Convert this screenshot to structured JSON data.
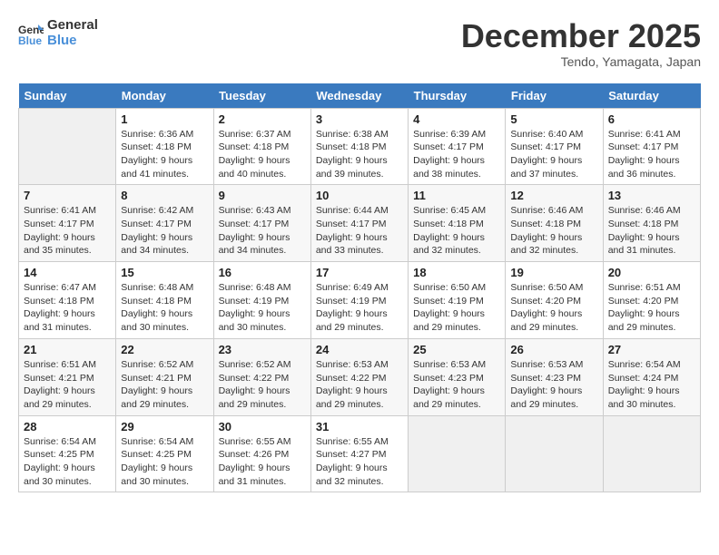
{
  "logo": {
    "line1": "General",
    "line2": "Blue"
  },
  "title": "December 2025",
  "subtitle": "Tendo, Yamagata, Japan",
  "days_of_week": [
    "Sunday",
    "Monday",
    "Tuesday",
    "Wednesday",
    "Thursday",
    "Friday",
    "Saturday"
  ],
  "weeks": [
    [
      {
        "day": "",
        "sunrise": "",
        "sunset": "",
        "daylight": ""
      },
      {
        "day": "1",
        "sunrise": "Sunrise: 6:36 AM",
        "sunset": "Sunset: 4:18 PM",
        "daylight": "Daylight: 9 hours and 41 minutes."
      },
      {
        "day": "2",
        "sunrise": "Sunrise: 6:37 AM",
        "sunset": "Sunset: 4:18 PM",
        "daylight": "Daylight: 9 hours and 40 minutes."
      },
      {
        "day": "3",
        "sunrise": "Sunrise: 6:38 AM",
        "sunset": "Sunset: 4:18 PM",
        "daylight": "Daylight: 9 hours and 39 minutes."
      },
      {
        "day": "4",
        "sunrise": "Sunrise: 6:39 AM",
        "sunset": "Sunset: 4:17 PM",
        "daylight": "Daylight: 9 hours and 38 minutes."
      },
      {
        "day": "5",
        "sunrise": "Sunrise: 6:40 AM",
        "sunset": "Sunset: 4:17 PM",
        "daylight": "Daylight: 9 hours and 37 minutes."
      },
      {
        "day": "6",
        "sunrise": "Sunrise: 6:41 AM",
        "sunset": "Sunset: 4:17 PM",
        "daylight": "Daylight: 9 hours and 36 minutes."
      }
    ],
    [
      {
        "day": "7",
        "sunrise": "Sunrise: 6:41 AM",
        "sunset": "Sunset: 4:17 PM",
        "daylight": "Daylight: 9 hours and 35 minutes."
      },
      {
        "day": "8",
        "sunrise": "Sunrise: 6:42 AM",
        "sunset": "Sunset: 4:17 PM",
        "daylight": "Daylight: 9 hours and 34 minutes."
      },
      {
        "day": "9",
        "sunrise": "Sunrise: 6:43 AM",
        "sunset": "Sunset: 4:17 PM",
        "daylight": "Daylight: 9 hours and 34 minutes."
      },
      {
        "day": "10",
        "sunrise": "Sunrise: 6:44 AM",
        "sunset": "Sunset: 4:17 PM",
        "daylight": "Daylight: 9 hours and 33 minutes."
      },
      {
        "day": "11",
        "sunrise": "Sunrise: 6:45 AM",
        "sunset": "Sunset: 4:18 PM",
        "daylight": "Daylight: 9 hours and 32 minutes."
      },
      {
        "day": "12",
        "sunrise": "Sunrise: 6:46 AM",
        "sunset": "Sunset: 4:18 PM",
        "daylight": "Daylight: 9 hours and 32 minutes."
      },
      {
        "day": "13",
        "sunrise": "Sunrise: 6:46 AM",
        "sunset": "Sunset: 4:18 PM",
        "daylight": "Daylight: 9 hours and 31 minutes."
      }
    ],
    [
      {
        "day": "14",
        "sunrise": "Sunrise: 6:47 AM",
        "sunset": "Sunset: 4:18 PM",
        "daylight": "Daylight: 9 hours and 31 minutes."
      },
      {
        "day": "15",
        "sunrise": "Sunrise: 6:48 AM",
        "sunset": "Sunset: 4:18 PM",
        "daylight": "Daylight: 9 hours and 30 minutes."
      },
      {
        "day": "16",
        "sunrise": "Sunrise: 6:48 AM",
        "sunset": "Sunset: 4:19 PM",
        "daylight": "Daylight: 9 hours and 30 minutes."
      },
      {
        "day": "17",
        "sunrise": "Sunrise: 6:49 AM",
        "sunset": "Sunset: 4:19 PM",
        "daylight": "Daylight: 9 hours and 29 minutes."
      },
      {
        "day": "18",
        "sunrise": "Sunrise: 6:50 AM",
        "sunset": "Sunset: 4:19 PM",
        "daylight": "Daylight: 9 hours and 29 minutes."
      },
      {
        "day": "19",
        "sunrise": "Sunrise: 6:50 AM",
        "sunset": "Sunset: 4:20 PM",
        "daylight": "Daylight: 9 hours and 29 minutes."
      },
      {
        "day": "20",
        "sunrise": "Sunrise: 6:51 AM",
        "sunset": "Sunset: 4:20 PM",
        "daylight": "Daylight: 9 hours and 29 minutes."
      }
    ],
    [
      {
        "day": "21",
        "sunrise": "Sunrise: 6:51 AM",
        "sunset": "Sunset: 4:21 PM",
        "daylight": "Daylight: 9 hours and 29 minutes."
      },
      {
        "day": "22",
        "sunrise": "Sunrise: 6:52 AM",
        "sunset": "Sunset: 4:21 PM",
        "daylight": "Daylight: 9 hours and 29 minutes."
      },
      {
        "day": "23",
        "sunrise": "Sunrise: 6:52 AM",
        "sunset": "Sunset: 4:22 PM",
        "daylight": "Daylight: 9 hours and 29 minutes."
      },
      {
        "day": "24",
        "sunrise": "Sunrise: 6:53 AM",
        "sunset": "Sunset: 4:22 PM",
        "daylight": "Daylight: 9 hours and 29 minutes."
      },
      {
        "day": "25",
        "sunrise": "Sunrise: 6:53 AM",
        "sunset": "Sunset: 4:23 PM",
        "daylight": "Daylight: 9 hours and 29 minutes."
      },
      {
        "day": "26",
        "sunrise": "Sunrise: 6:53 AM",
        "sunset": "Sunset: 4:23 PM",
        "daylight": "Daylight: 9 hours and 29 minutes."
      },
      {
        "day": "27",
        "sunrise": "Sunrise: 6:54 AM",
        "sunset": "Sunset: 4:24 PM",
        "daylight": "Daylight: 9 hours and 30 minutes."
      }
    ],
    [
      {
        "day": "28",
        "sunrise": "Sunrise: 6:54 AM",
        "sunset": "Sunset: 4:25 PM",
        "daylight": "Daylight: 9 hours and 30 minutes."
      },
      {
        "day": "29",
        "sunrise": "Sunrise: 6:54 AM",
        "sunset": "Sunset: 4:25 PM",
        "daylight": "Daylight: 9 hours and 30 minutes."
      },
      {
        "day": "30",
        "sunrise": "Sunrise: 6:55 AM",
        "sunset": "Sunset: 4:26 PM",
        "daylight": "Daylight: 9 hours and 31 minutes."
      },
      {
        "day": "31",
        "sunrise": "Sunrise: 6:55 AM",
        "sunset": "Sunset: 4:27 PM",
        "daylight": "Daylight: 9 hours and 32 minutes."
      },
      {
        "day": "",
        "sunrise": "",
        "sunset": "",
        "daylight": ""
      },
      {
        "day": "",
        "sunrise": "",
        "sunset": "",
        "daylight": ""
      },
      {
        "day": "",
        "sunrise": "",
        "sunset": "",
        "daylight": ""
      }
    ]
  ]
}
